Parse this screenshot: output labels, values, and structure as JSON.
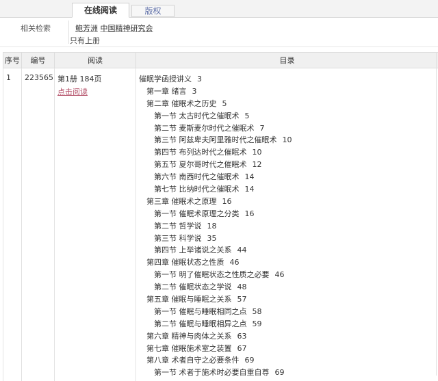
{
  "tabs": [
    {
      "label": "在线阅读",
      "active": true
    },
    {
      "label": "版权",
      "active": false
    }
  ],
  "related": {
    "label": "相关检索",
    "authors": [
      "鲍芳洲",
      "中国精神研究会"
    ],
    "note": "只有上册"
  },
  "table": {
    "headers": [
      "序号",
      "编号",
      "阅读",
      "目录"
    ],
    "row": {
      "index": "1",
      "code": "223565",
      "volume": "第1册 184页",
      "read_link": "点击阅读"
    }
  },
  "toc": [
    {
      "text": "催眠学函授讲义",
      "page": "3",
      "level": 0
    },
    {
      "text": "第一章 绪言",
      "page": "3",
      "level": 1
    },
    {
      "text": "第二章 催眠术之历史",
      "page": "5",
      "level": 1
    },
    {
      "text": "第一节 太古时代之催眠术",
      "page": "5",
      "level": 2
    },
    {
      "text": "第二节 麦斯麦尔时代之催眠术",
      "page": "7",
      "level": 2
    },
    {
      "text": "第三节 阿兹卑夫阿里雅时代之催眠术",
      "page": "10",
      "level": 2
    },
    {
      "text": "第四节 布列达时代之催眠术",
      "page": "10",
      "level": 2
    },
    {
      "text": "第五节 夏尔哥时代之催眠术",
      "page": "12",
      "level": 2
    },
    {
      "text": "第六节 南西时代之催眠术",
      "page": "14",
      "level": 2
    },
    {
      "text": "第七节 比纳时代之催眠术",
      "page": "14",
      "level": 2
    },
    {
      "text": "第三章 催眠术之原理",
      "page": "16",
      "level": 1
    },
    {
      "text": "第一节 催眠术原理之分类",
      "page": "16",
      "level": 2
    },
    {
      "text": "第二节 哲学说",
      "page": "18",
      "level": 2
    },
    {
      "text": "第三节 科学说",
      "page": "35",
      "level": 2
    },
    {
      "text": "第四节 上举诸说之关系",
      "page": "44",
      "level": 2
    },
    {
      "text": "第四章 催眠状态之性质",
      "page": "46",
      "level": 1
    },
    {
      "text": "第一节 明了催眠状态之性质之必要",
      "page": "46",
      "level": 2
    },
    {
      "text": "第二节 催眠状态之学说",
      "page": "48",
      "level": 2
    },
    {
      "text": "第五章 催眠与睡眠之关系",
      "page": "57",
      "level": 1
    },
    {
      "text": "第一节 催眠与睡眠相同之点",
      "page": "58",
      "level": 2
    },
    {
      "text": "第二节 催眠与睡眠相异之点",
      "page": "59",
      "level": 2
    },
    {
      "text": "第六章 精神与肉体之关系",
      "page": "63",
      "level": 1
    },
    {
      "text": "第七章 催眠施术室之装置",
      "page": "67",
      "level": 1
    },
    {
      "text": "第八章 术者自守之必要条件",
      "page": "69",
      "level": 1
    },
    {
      "text": "第一节 术者于施术时必要自重自尊",
      "page": "69",
      "level": 2
    }
  ]
}
